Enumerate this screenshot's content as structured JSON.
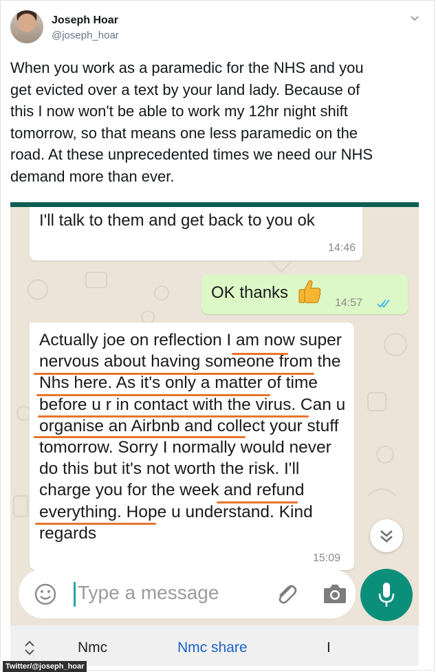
{
  "tweet": {
    "author_name": "Joseph Hoar",
    "author_handle": "@joseph_hoar",
    "text": "When you work as a paramedic for the NHS and you\nget evicted over a text by your land lady. Because of\nthis I now won't be able to work my 12hr night shift\ntomorrow, so that means one less paramedic on the\nroad. At these unprecedented times we need our NHS\ndemand more than ever."
  },
  "whatsapp": {
    "messages": [
      {
        "direction": "incoming",
        "text": "I'll talk to them and get back to you ok",
        "time": "14:46"
      },
      {
        "direction": "outgoing",
        "text": "OK thanks",
        "emoji": "thumbs-up",
        "time": "14:57",
        "status": "read"
      },
      {
        "direction": "incoming",
        "text": "Actually joe on reflection I am now super nervous about having someone from the Nhs here. As it's only a matter of time before u r in contact with the virus. Can u organise an Airbnb and collect your stuff tomorrow. Sorry I normally would never do this but it's not worth the risk. I'll charge you for the week and refund everything. Hope u understand. Kind regards",
        "time": "15:09"
      }
    ],
    "input_placeholder": "Type a message",
    "keyboard_suggestions": [
      "Nmc",
      "Nmc share",
      "I"
    ],
    "colors": {
      "header": "#0b5e53",
      "outgoing": "#dcf8c6",
      "accent": "#0b8f7a",
      "highlight": "#e8742a"
    }
  },
  "watermark": "Twitter/@joseph_hoar"
}
